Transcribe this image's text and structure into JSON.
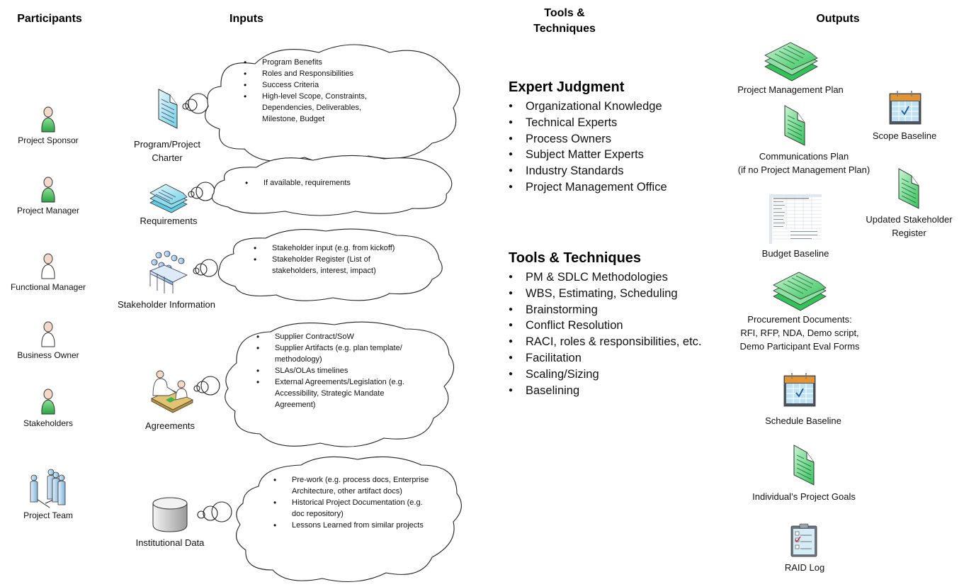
{
  "headers": {
    "participants": "Participants",
    "inputs": "Inputs",
    "tools": [
      "Tools &",
      "Techniques"
    ],
    "outputs": "Outputs"
  },
  "participants": [
    {
      "label": "Project Sponsor",
      "icon": "person-green-icon"
    },
    {
      "label": "Project Manager",
      "icon": "person-green-icon"
    },
    {
      "label": "Functional Manager",
      "icon": "person-white-icon"
    },
    {
      "label": "Business Owner",
      "icon": "person-white-icon"
    },
    {
      "label": "Stakeholders",
      "icon": "person-green-icon"
    },
    {
      "label": "Project Team",
      "icon": "team-icon"
    }
  ],
  "inputs": [
    {
      "label": [
        "Program/Project",
        "Charter"
      ],
      "icon": "document-icon",
      "items": [
        "Program Benefits",
        "Roles and Responsibilities",
        "Success Criteria",
        "High-level Scope, Constraints, Dependencies, Deliverables, Milestone, Budget"
      ]
    },
    {
      "label": [
        "Requirements"
      ],
      "icon": "document-stack-icon",
      "items": [
        "If available, requirements"
      ]
    },
    {
      "label": [
        "Stakeholder Information"
      ],
      "icon": "meeting-icon",
      "items": [
        "Stakeholder input (e.g. from kickoff)",
        "Stakeholder Register (List of stakeholders, interest, impact)"
      ]
    },
    {
      "label": [
        "Agreements"
      ],
      "icon": "agreement-icon",
      "items": [
        "Supplier Contract/SoW",
        "Supplier Artifacts (e.g. plan template/ methodology)",
        "SLAs/OLAs timelines",
        "External Agreements/Legislation (e.g. Accessibility, Strategic Mandate Agreement)"
      ]
    },
    {
      "label": [
        "Institutional Data"
      ],
      "icon": "database-icon",
      "items": [
        "Pre-work (e.g. process docs, Enterprise Architecture, other artifact docs)",
        "Historical Project Documentation (e.g. doc repository)",
        "Lessons Learned from similar projects"
      ]
    }
  ],
  "tools": {
    "expert_judgment": {
      "title": "Expert Judgment",
      "items": [
        "Organizational Knowledge",
        "Technical Experts",
        "Process Owners",
        "Subject Matter Experts",
        "Industry Standards",
        "Project Management Office"
      ]
    },
    "techniques": {
      "title": "Tools & Techniques",
      "items": [
        "PM & SDLC Methodologies",
        "WBS, Estimating, Scheduling",
        "Brainstorming",
        "Conflict Resolution",
        "RACI, roles & responsibilities, etc.",
        "Facilitation",
        "Scaling/Sizing",
        "Baselining"
      ]
    }
  },
  "outputs": [
    {
      "label": [
        "Project Management Plan"
      ],
      "icon": "document-stack-green-icon"
    },
    {
      "label": [
        "Scope Baseline"
      ],
      "icon": "calendar-icon"
    },
    {
      "label": [
        "Communications Plan",
        "(if no Project Management Plan)"
      ],
      "icon": "document-green-icon"
    },
    {
      "label": [
        "Updated Stakeholder",
        "Register"
      ],
      "icon": "document-green-icon"
    },
    {
      "label": [
        "Budget Baseline"
      ],
      "icon": "spreadsheet-icon"
    },
    {
      "label": [
        "Procurement Documents:",
        "RFI, RFP, NDA, Demo script,",
        "Demo Participant Eval Forms"
      ],
      "icon": "document-stack-green-icon"
    },
    {
      "label": [
        "Schedule Baseline"
      ],
      "icon": "calendar-icon"
    },
    {
      "label": [
        "Individual’s Project Goals"
      ],
      "icon": "document-green-icon"
    },
    {
      "label": [
        "RAID Log"
      ],
      "icon": "clipboard-checklist-icon"
    }
  ],
  "colors": {
    "green_fill": "#5fd67a",
    "blue_fill": "#aee3ef",
    "calendar_orange": "#e09434"
  }
}
